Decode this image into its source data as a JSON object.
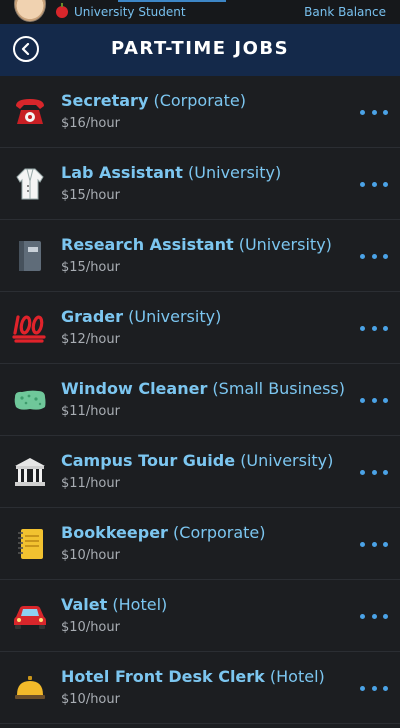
{
  "status": {
    "role": "University Student",
    "bank_label": "Bank Balance"
  },
  "header": {
    "title": "PART-TIME JOBS"
  },
  "jobs": [
    {
      "name": "Secretary",
      "employer": "(Corporate)",
      "wage": "$16/hour",
      "icon": "telephone-icon"
    },
    {
      "name": "Lab Assistant",
      "employer": "(University)",
      "wage": "$15/hour",
      "icon": "lab-coat-icon"
    },
    {
      "name": "Research Assistant",
      "employer": "(University)",
      "wage": "$15/hour",
      "icon": "notebook-icon"
    },
    {
      "name": "Grader",
      "employer": "(University)",
      "wage": "$12/hour",
      "icon": "hundred-points-icon"
    },
    {
      "name": "Window Cleaner",
      "employer": "(Small Business)",
      "wage": "$11/hour",
      "icon": "sponge-icon"
    },
    {
      "name": "Campus Tour Guide",
      "employer": "(University)",
      "wage": "$11/hour",
      "icon": "classical-building-icon"
    },
    {
      "name": "Bookkeeper",
      "employer": "(Corporate)",
      "wage": "$10/hour",
      "icon": "ledger-icon"
    },
    {
      "name": "Valet",
      "employer": "(Hotel)",
      "wage": "$10/hour",
      "icon": "car-icon"
    },
    {
      "name": "Hotel Front Desk Clerk",
      "employer": "(Hotel)",
      "wage": "$10/hour",
      "icon": "bellhop-bell-icon"
    }
  ],
  "colors": {
    "background": "#1c1e21",
    "header": "#14294a",
    "accent": "#7cc6f0",
    "dots": "#4ba3e6"
  }
}
